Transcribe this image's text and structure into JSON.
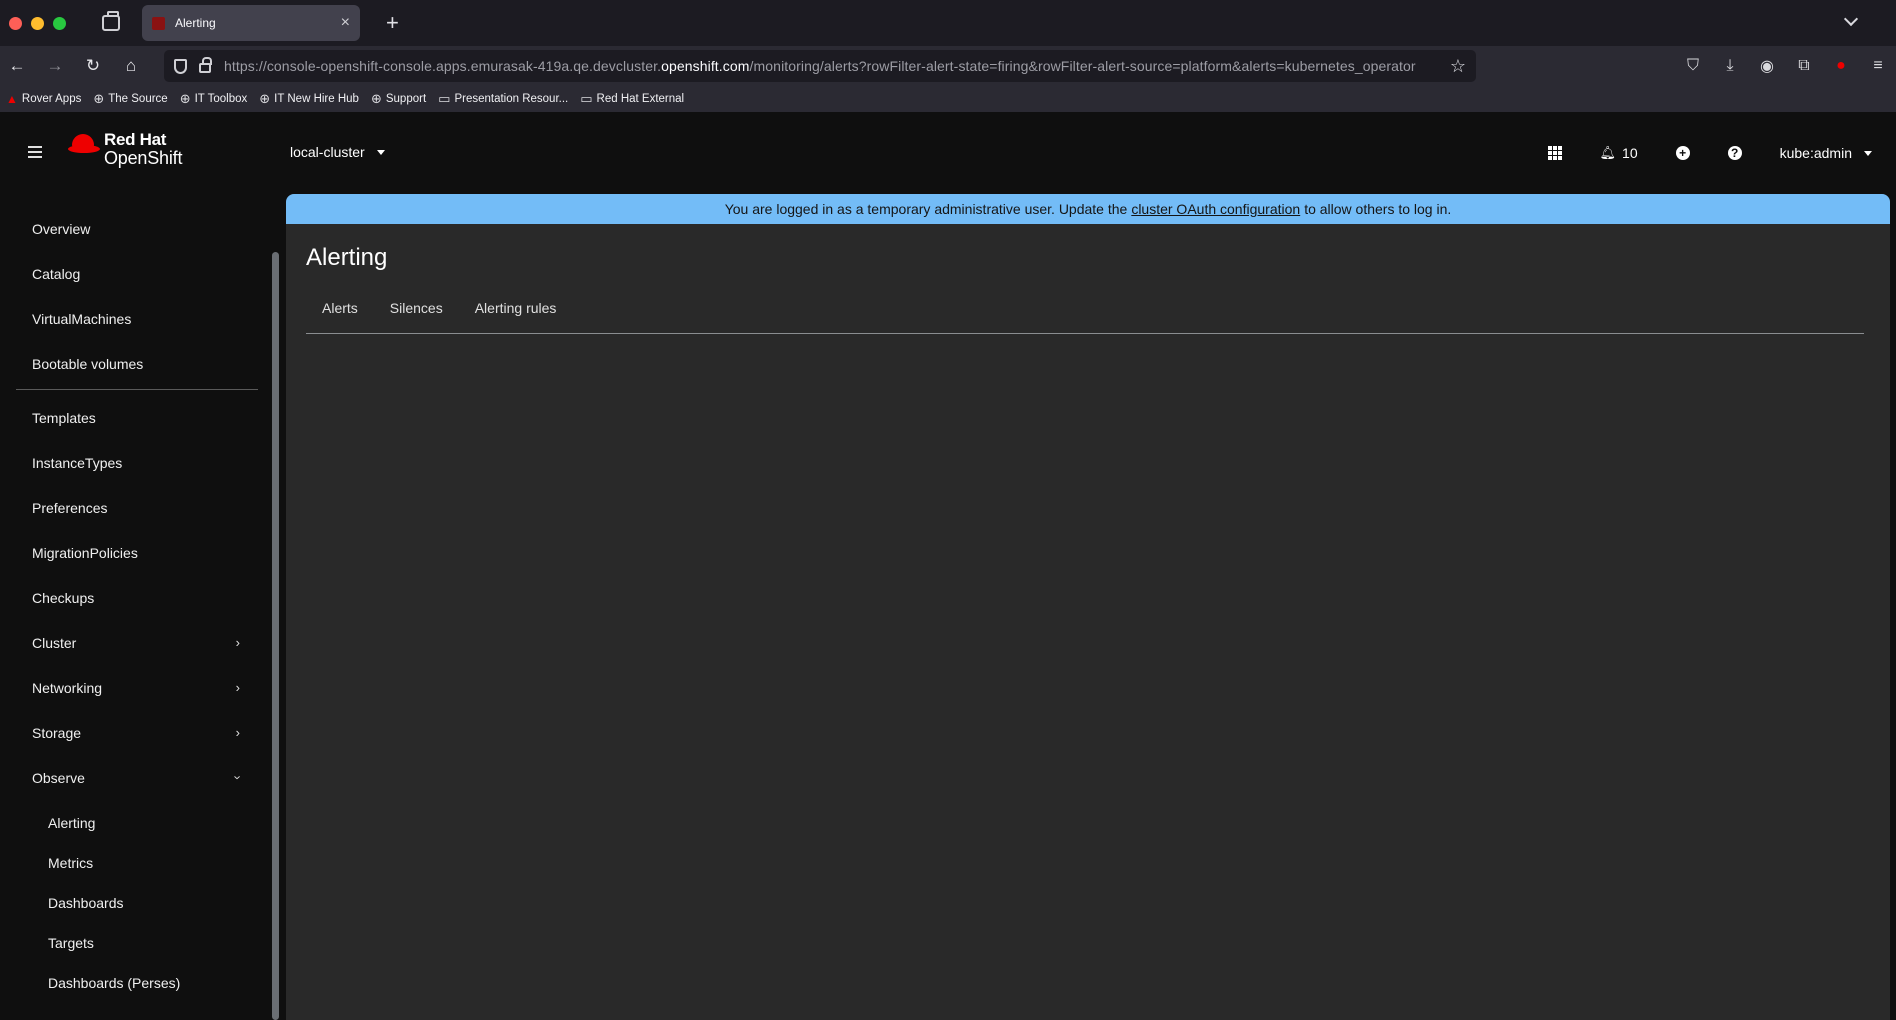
{
  "browser": {
    "tab_title": "Alerting",
    "url_prefix": "https://console-openshift-console.apps.emurasak-419a.qe.devcluster.",
    "url_domain": "openshift.com",
    "url_suffix": "/monitoring/alerts?rowFilter-alert-state=firing&rowFilter-alert-source=platform&alerts=kubernetes_operator",
    "bookmarks": [
      "Rover Apps",
      "The Source",
      "IT Toolbox",
      "IT New Hire Hub",
      "Support",
      "Presentation Resour...",
      "Red Hat External"
    ]
  },
  "masthead": {
    "brand_line1": "Red Hat",
    "brand_line2": "OpenShift",
    "cluster": "local-cluster",
    "notification_count": "10",
    "user": "kube:admin"
  },
  "sidebar": {
    "items": [
      "Overview",
      "Catalog",
      "VirtualMachines",
      "Bootable volumes",
      "Templates",
      "InstanceTypes",
      "Preferences",
      "MigrationPolicies",
      "Checkups",
      "Cluster",
      "Networking",
      "Storage",
      "Observe"
    ],
    "observe_children": [
      "Alerting",
      "Metrics",
      "Dashboards",
      "Targets",
      "Dashboards (Perses)"
    ]
  },
  "banner": {
    "text_before": "You are logged in as a temporary administrative user. Update the",
    "link": "cluster OAuth configuration",
    "text_after": "to allow others to log in."
  },
  "page": {
    "title": "Alerting",
    "tabs": [
      "Alerts",
      "Silences",
      "Alerting rules"
    ]
  }
}
